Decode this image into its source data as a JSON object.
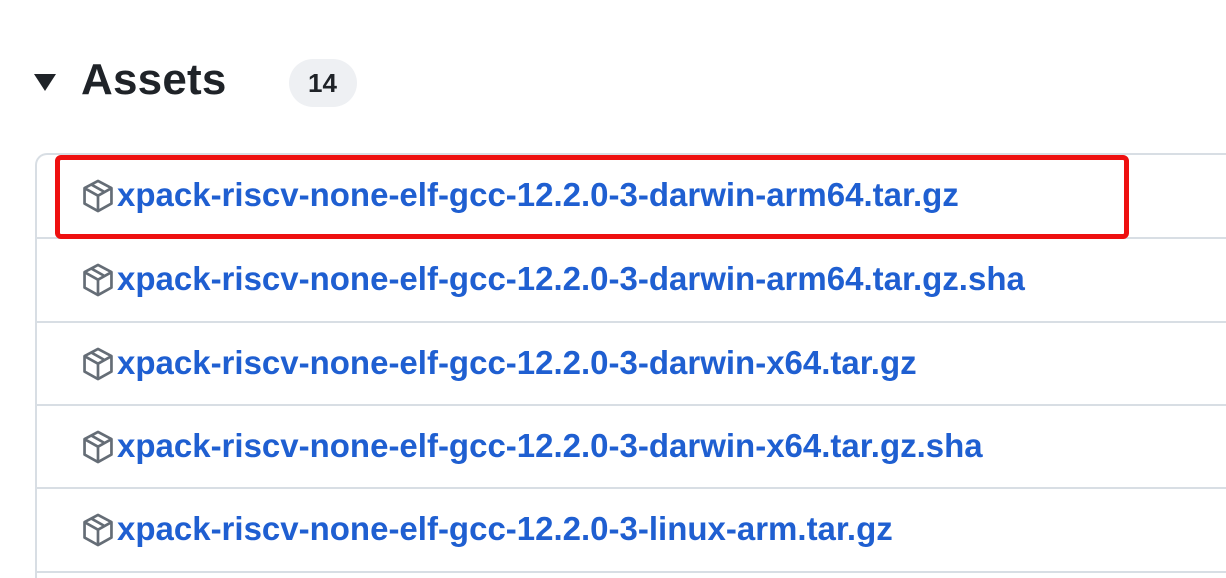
{
  "header": {
    "title": "Assets",
    "count": "14"
  },
  "assets": [
    {
      "name": "xpack-riscv-none-elf-gcc-12.2.0-3-darwin-arm64.tar.gz",
      "icon": "package-icon",
      "highlighted": true
    },
    {
      "name": "xpack-riscv-none-elf-gcc-12.2.0-3-darwin-arm64.tar.gz.sha",
      "icon": "package-icon"
    },
    {
      "name": "xpack-riscv-none-elf-gcc-12.2.0-3-darwin-x64.tar.gz",
      "icon": "package-icon"
    },
    {
      "name": "xpack-riscv-none-elf-gcc-12.2.0-3-darwin-x64.tar.gz.sha",
      "icon": "package-icon"
    },
    {
      "name": "xpack-riscv-none-elf-gcc-12.2.0-3-linux-arm.tar.gz",
      "icon": "package-icon"
    }
  ],
  "colors": {
    "link": "#1f5fd1",
    "highlight_border": "#ee1010",
    "text": "#1f2328",
    "badge_bg": "#eef0f3",
    "divider": "#d8dee4"
  }
}
